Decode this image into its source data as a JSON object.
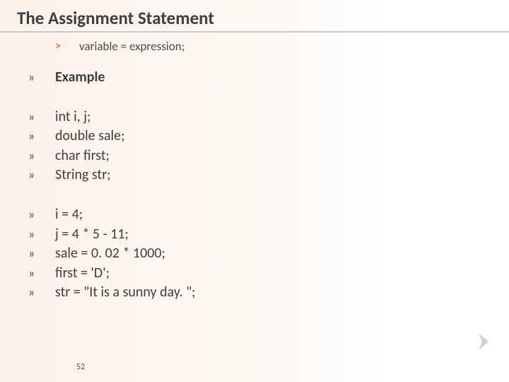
{
  "title": "The Assignment Statement",
  "syntax_bullet": "˃",
  "syntax": "variable = expression;",
  "groups": [
    {
      "lines": [
        {
          "text": "Example",
          "bold": true
        }
      ]
    },
    {
      "lines": [
        {
          "text": "int i, j;"
        },
        {
          "text": "double sale;"
        },
        {
          "text": "char first;"
        },
        {
          "text": "String str;"
        }
      ]
    },
    {
      "lines": [
        {
          "text": "i = 4;"
        },
        {
          "text": "j = 4 * 5 - 11;"
        },
        {
          "text": "sale = 0. 02 * 1000;"
        },
        {
          "text": "first = 'D';"
        },
        {
          "text": "str = \"It is a sunny day. \";"
        }
      ]
    }
  ],
  "bullet_glyph": "»",
  "page_number": "52",
  "icons": {
    "corner_arrow": "chevron-right"
  }
}
